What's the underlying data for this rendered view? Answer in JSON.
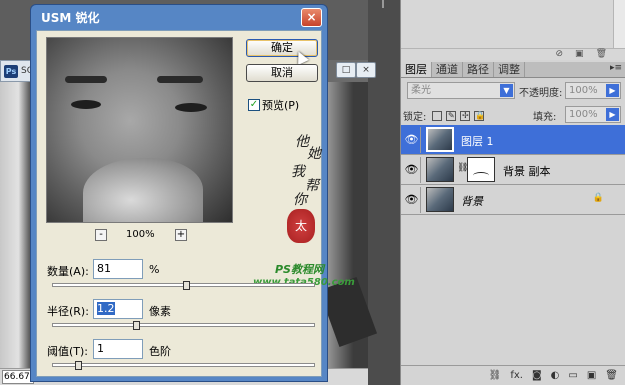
{
  "document": {
    "tab_label": "SO",
    "zoom": "66.67%",
    "window_buttons": [
      "□",
      "×"
    ]
  },
  "dialog": {
    "title": "USM 锐化",
    "close": "×",
    "ok_label": "确定",
    "cancel_label": "取消",
    "preview_label": "预览(P)",
    "preview_checked": "✓",
    "zoom_out": "-",
    "zoom_in": "+",
    "zoom_percent": "100%",
    "amount_label": "数量(A):",
    "amount_value": "81",
    "amount_unit": "%",
    "amount_level": 81,
    "radius_label": "半径(R):",
    "radius_value": "1.2",
    "radius_unit": "像素",
    "radius_level": 1.2,
    "threshold_label": "阈值(T):",
    "threshold_value": "1",
    "threshold_unit": "色阶",
    "threshold_level": 1,
    "watermark": {
      "chars": [
        "他",
        "她",
        "我",
        "帮",
        "你"
      ],
      "seal": "太",
      "site_name": "PS教程网",
      "site_url": "www.tata580.com"
    }
  },
  "layers_panel": {
    "tabs": [
      "图层",
      "通道",
      "路径",
      "调整"
    ],
    "blend_mode": "柔光",
    "opacity_label": "不透明度:",
    "opacity_value": "100%",
    "lock_label": "锁定:",
    "fill_label": "填充:",
    "fill_value": "100%",
    "layers": [
      {
        "name": "图层 1",
        "active": true
      },
      {
        "name": "背景 副本",
        "active": false
      },
      {
        "name": "背景",
        "active": false
      }
    ],
    "footer_icons": [
      "link-icon",
      "fx-icon",
      "mask-icon",
      "adjustment-icon",
      "group-icon",
      "new-layer-icon",
      "trash-icon"
    ],
    "footer_glyphs": [
      "⛓",
      "fx.",
      "◙",
      "◐",
      "▭",
      "▣",
      "🗑"
    ]
  }
}
